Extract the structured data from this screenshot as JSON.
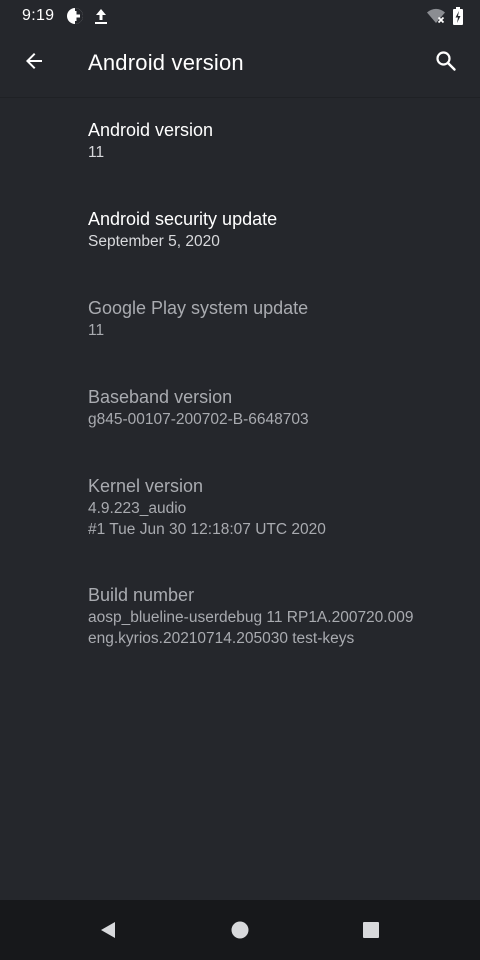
{
  "status_bar": {
    "time": "9:19",
    "left_icons": [
      "data-saver-icon",
      "upload-icon"
    ],
    "right_icons": [
      "wifi-off-icon",
      "battery-charging-icon"
    ]
  },
  "app_bar": {
    "title": "Android version",
    "back_icon": "arrow-back-icon",
    "search_icon": "search-icon"
  },
  "preferences": [
    {
      "title": "Android version",
      "summary": [
        "11"
      ],
      "enabled": true
    },
    {
      "title": "Android security update",
      "summary": [
        "September 5, 2020"
      ],
      "enabled": true
    },
    {
      "title": "Google Play system update",
      "summary": [
        "11"
      ],
      "enabled": false
    },
    {
      "title": "Baseband version",
      "summary": [
        "g845-00107-200702-B-6648703"
      ],
      "enabled": false
    },
    {
      "title": "Kernel version",
      "summary": [
        "4.9.223_audio",
        "#1 Tue Jun 30 12:18:07 UTC 2020"
      ],
      "enabled": false
    },
    {
      "title": "Build number",
      "summary": [
        "aosp_blueline-userdebug 11 RP1A.200720.009",
        "eng.kyrios.20210714.205030 test-keys"
      ],
      "enabled": false
    }
  ],
  "nav_bar": {
    "buttons": [
      "back-triangle-icon",
      "home-circle-icon",
      "recents-square-icon"
    ]
  },
  "colors": {
    "background": "#25272c",
    "nav_bar": "#17181b",
    "text_primary": "#ffffff",
    "text_disabled": "#a9abb0"
  }
}
